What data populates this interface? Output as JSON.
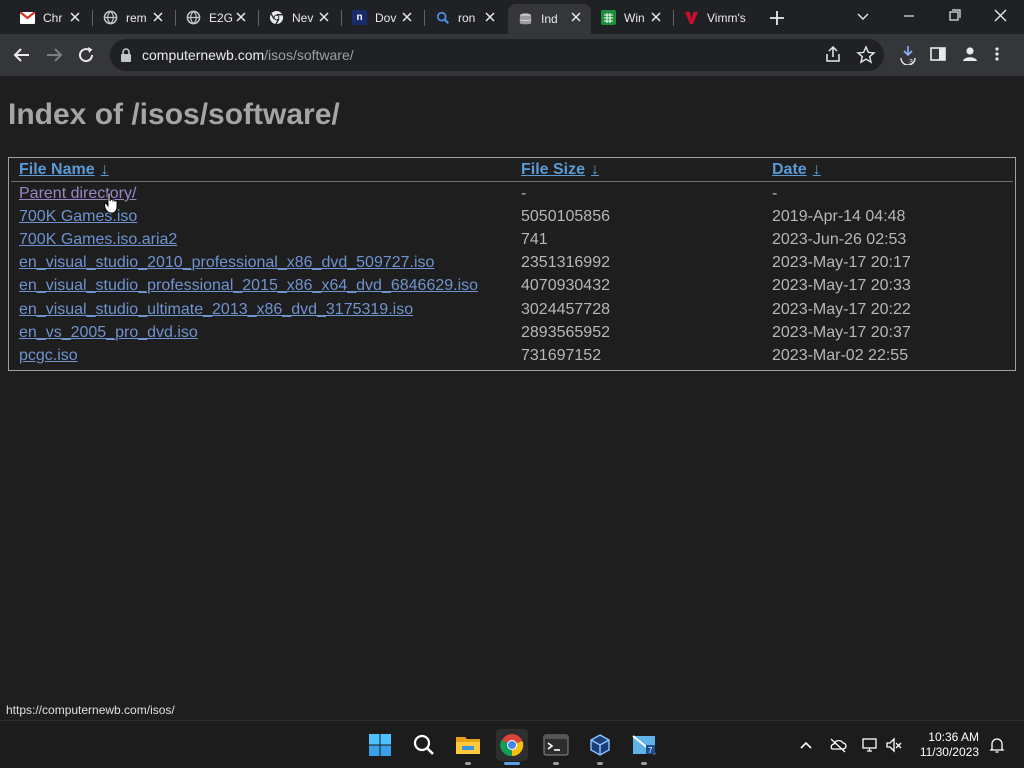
{
  "browser": {
    "tabs": [
      {
        "label": "Chr",
        "icon": "gmail-icon"
      },
      {
        "label": "rem",
        "icon": "globe-icon"
      },
      {
        "label": "E2G",
        "icon": "globe-icon"
      },
      {
        "label": "Nev",
        "icon": "chrome-icon"
      },
      {
        "label": "Dov",
        "icon": "n-app-icon"
      },
      {
        "label": "ron",
        "icon": "search-icon"
      },
      {
        "label": "Ind",
        "icon": "server-icon",
        "active": true
      },
      {
        "label": "Win",
        "icon": "sheet-icon"
      },
      {
        "label": "Vimm's",
        "icon": "vimms-icon"
      }
    ],
    "address": {
      "host": "computernewb.com",
      "path": "/isos/software/"
    }
  },
  "page": {
    "title": "Index of /isos/software/",
    "columns": {
      "name": "File Name",
      "size": "File Size",
      "date": "Date",
      "sort_arrow": "↓"
    },
    "rows": [
      {
        "name": "Parent directory/",
        "size": "-",
        "date": "-",
        "visited": true
      },
      {
        "name": "700K Games.iso",
        "size": "5050105856",
        "date": "2019-Apr-14 04:48"
      },
      {
        "name": "700K Games.iso.aria2",
        "size": "741",
        "date": "2023-Jun-26 02:53"
      },
      {
        "name": "en_visual_studio_2010_professional_x86_dvd_509727.iso",
        "size": "2351316992",
        "date": "2023-May-17 20:17"
      },
      {
        "name": "en_visual_studio_professional_2015_x86_x64_dvd_6846629.iso",
        "size": "4070930432",
        "date": "2023-May-17 20:33"
      },
      {
        "name": "en_visual_studio_ultimate_2013_x86_dvd_3175319.iso",
        "size": "3024457728",
        "date": "2023-May-17 20:22"
      },
      {
        "name": "en_vs_2005_pro_dvd.iso",
        "size": "2893565952",
        "date": "2023-May-17 20:37"
      },
      {
        "name": "pcgc.iso",
        "size": "731697152",
        "date": "2023-Mar-02 22:55"
      }
    ]
  },
  "status_url": "https://computernewb.com/isos/",
  "taskbar": {
    "apps": [
      "windows-start-icon",
      "search-icon",
      "file-explorer-icon",
      "chrome-icon",
      "terminal-icon",
      "virtualbox-icon",
      "utility-icon"
    ],
    "time": "10:36 AM",
    "date": "11/30/2023"
  },
  "colors": {
    "link": "#6f93cf",
    "visited": "#9a86c5",
    "background": "#1e1e1e",
    "accent": "#5aa0e8"
  }
}
